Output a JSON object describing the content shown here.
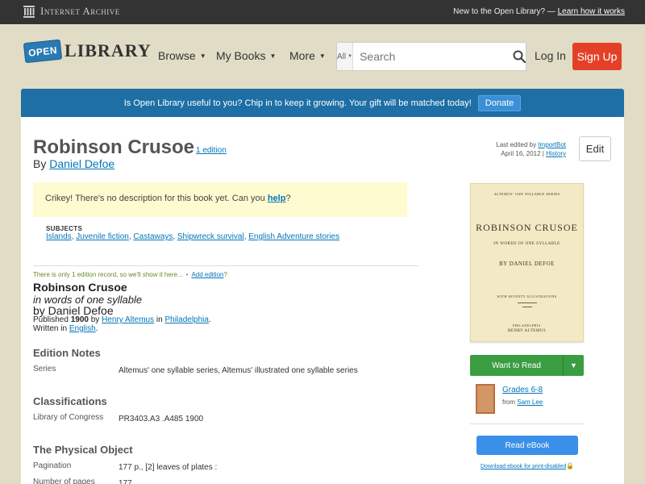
{
  "iabar": {
    "logo_text": "Internet Archive",
    "new_text": "New to the Open Library? —",
    "learn_link": "Learn how it works"
  },
  "header": {
    "logo_badge": "OPEN",
    "logo_word": "LIBRARY",
    "nav": [
      {
        "label": "Browse"
      },
      {
        "label": "My Books"
      },
      {
        "label": "More"
      }
    ],
    "search_scope": "All",
    "search_placeholder": "Search",
    "login": "Log In",
    "signup": "Sign Up"
  },
  "donate": {
    "text": "Is Open Library useful to you? Chip in to keep it growing. Your gift will be matched today!",
    "button": "Donate"
  },
  "work": {
    "title": "Robinson Crusoe",
    "edition_count": "1 edition",
    "by": "By",
    "author": "Daniel Defoe",
    "last_edited_prefix": "Last edited by",
    "last_edited_by": "ImportBot",
    "last_edited_date": "April 16, 2012",
    "history": "History",
    "edit": "Edit",
    "nodesc_pre": "Crikey! There's no description for this book yet. Can you",
    "nodesc_link": "help",
    "nodesc_post": "?",
    "subjects_heading": "SUBJECTS",
    "subjects": [
      "Islands",
      "Juvenile fiction",
      "Castaways",
      "Shipwreck survival",
      "English Adventure stories"
    ]
  },
  "edition": {
    "only_one": "There is only 1 edition record, so we'll show it here...",
    "add_edition": "Add edition",
    "add_edition_suffix": "?",
    "title": "Robinson Crusoe",
    "subtitle": "in words of one syllable",
    "by_line": "by Daniel Defoe",
    "published_prefix": "Published",
    "year": "1900",
    "by": "by",
    "publisher": "Henry Altemus",
    "in": "in",
    "place": "Philadelphia",
    "written_prefix": "Written in",
    "language": "English"
  },
  "sections": {
    "edition_notes": {
      "heading": "Edition Notes",
      "label": "Series",
      "value": "Altemus' one syllable series, Altemus' illustrated one syllable series"
    },
    "classifications": {
      "heading": "Classifications",
      "label": "Library of Congress",
      "value": "PR3403.A3 .A485 1900"
    },
    "physical": {
      "heading": "The Physical Object",
      "pagination_label": "Pagination",
      "pagination_value": "177 p., [2] leaves of plates :",
      "pages_label": "Number of pages",
      "pages_value": "177"
    }
  },
  "cover": {
    "series": "ALTEMUS' ONE SYLLABLE SERIES",
    "title": "ROBINSON CRUSOE",
    "subtitle": "IN WORDS OF ONE SYLLABLE",
    "author": "BY DANIEL DEFOE",
    "illustrations": "WITH SEVENTY ILLUSTRATIONS",
    "place": "PHILADELPHIA",
    "publisher": "HENRY ALTEMUS"
  },
  "sidebar": {
    "want_to_read": "Want to Read",
    "list_name": "Grades 6-8",
    "list_from_prefix": "from",
    "list_from": "Sam Lee",
    "read_ebook": "Read eBook",
    "print_disabled": "Download ebook for print-disabled"
  },
  "colors": {
    "signup": "#e44028",
    "donate_banner": "#1d6fa5",
    "want_to_read": "#3b9d42",
    "read_ebook": "#3a8fe8",
    "link": "#0376b8",
    "page_bg": "#e1dcc5"
  }
}
